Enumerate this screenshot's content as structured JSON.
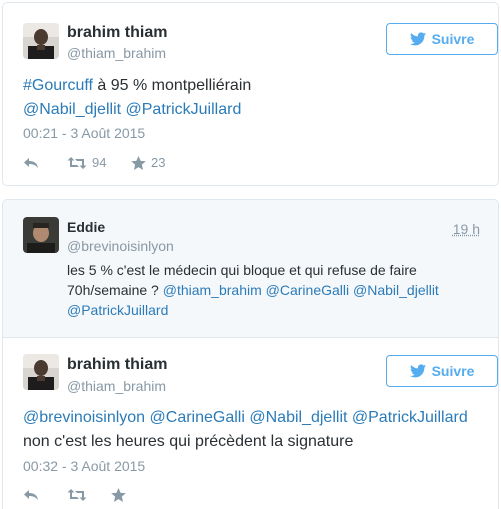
{
  "tweet1": {
    "name": "brahim thiam",
    "handle": "@thiam_brahim",
    "follow_label": "Suivre",
    "text_hashtag": "#Gourcuff",
    "text_plain": " à 95 % montpelliérain",
    "mention1": "@Nabil_djellit",
    "mention2": "@PatrickJuillard",
    "timestamp": "00:21 - 3 Août 2015",
    "retweets": "94",
    "likes": "23"
  },
  "reply": {
    "name": "Eddie",
    "handle": "@brevinoisinlyon",
    "time_ago": "19 h",
    "text_line1": "les 5 % c'est le médecin qui bloque et qui refuse de faire",
    "text_line2_plain": "70h/semaine ? ",
    "mention1": "@thiam_brahim",
    "mention2": "@CarineGalli",
    "mention3": "@Nabil_djellit",
    "mention4": "@PatrickJuillard"
  },
  "tweet2": {
    "name": "brahim thiam",
    "handle": "@thiam_brahim",
    "follow_label": "Suivre",
    "mention1": "@brevinoisinlyon",
    "mention2": "@CarineGalli",
    "mention3": "@Nabil_djellit",
    "mention4": "@PatrickJuillard",
    "text_line2": "non c'est les heures qui précèdent la signature",
    "timestamp": "00:32 - 3 Août 2015"
  },
  "colors": {
    "link": "#2b7bb9",
    "follow_blue": "#55acee",
    "muted": "#8899a6",
    "reply_bg": "#f5f8fa"
  },
  "icons": [
    "bird-icon",
    "reply-icon",
    "retweet-icon",
    "star-icon"
  ]
}
